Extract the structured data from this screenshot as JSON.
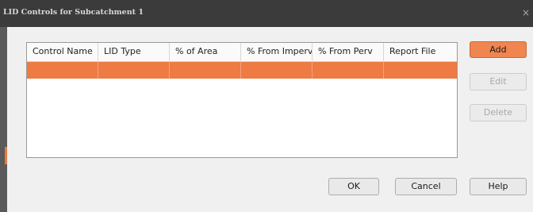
{
  "window": {
    "title": "LID Controls for Subcatchment 1",
    "close_glyph": "×"
  },
  "table": {
    "columns": [
      "Control Name",
      "LID Type",
      "% of Area",
      "% From Imperv",
      "% From Perv",
      "Report File"
    ],
    "rows": [
      [
        "",
        "",
        "",
        "",
        "",
        ""
      ]
    ]
  },
  "buttons": {
    "add": "Add",
    "edit": "Edit",
    "delete": "Delete",
    "ok": "OK",
    "cancel": "Cancel",
    "help": "Help"
  },
  "colors": {
    "accent": "#ee7a44",
    "titlebar": "#3b3b3b"
  }
}
